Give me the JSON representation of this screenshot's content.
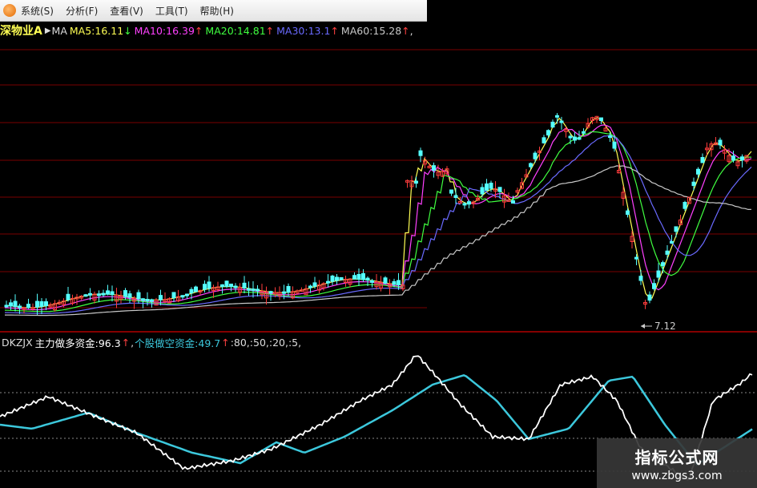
{
  "menu": {
    "items": [
      "系统(S)",
      "分析(F)",
      "查看(V)",
      "工具(T)",
      "帮助(H)"
    ]
  },
  "stock": {
    "name": "深物业A",
    "ma_label": "MA",
    "ma": [
      {
        "text": "MA5:16.11",
        "arrow": "↓",
        "color": "#ffff54"
      },
      {
        "text": "MA10:16.39",
        "arrow": "↑",
        "color": "#ff40ff"
      },
      {
        "text": "MA20:14.81",
        "arrow": "↑",
        "color": "#40ff40"
      },
      {
        "text": "MA30:13.1",
        "arrow": "↑",
        "color": "#6a6aff"
      },
      {
        "text": "MA60:15.28",
        "arrow": "↑",
        "color": "#c8c8c8"
      }
    ],
    "low_label": "7.12"
  },
  "indicator": {
    "name": "DKZJX",
    "main_label": "主力做多资金:96.3",
    "main_arrow": "↑",
    "retail_label": "个股做空资金:49.7",
    "retail_arrow": "↑",
    "levels_label": ":80,:50,:20,:5,"
  },
  "colors": {
    "up": "#ff3c3c",
    "down": "#54ffff",
    "grid_red": "#7a0000",
    "main_line": "#ffffff",
    "retail_line": "#3cc8dc",
    "arrow_up": "#ff4040",
    "arrow_down": "#40ff40"
  },
  "watermark": {
    "title": "指标公式网",
    "url": "www.zbgs3.com"
  }
}
